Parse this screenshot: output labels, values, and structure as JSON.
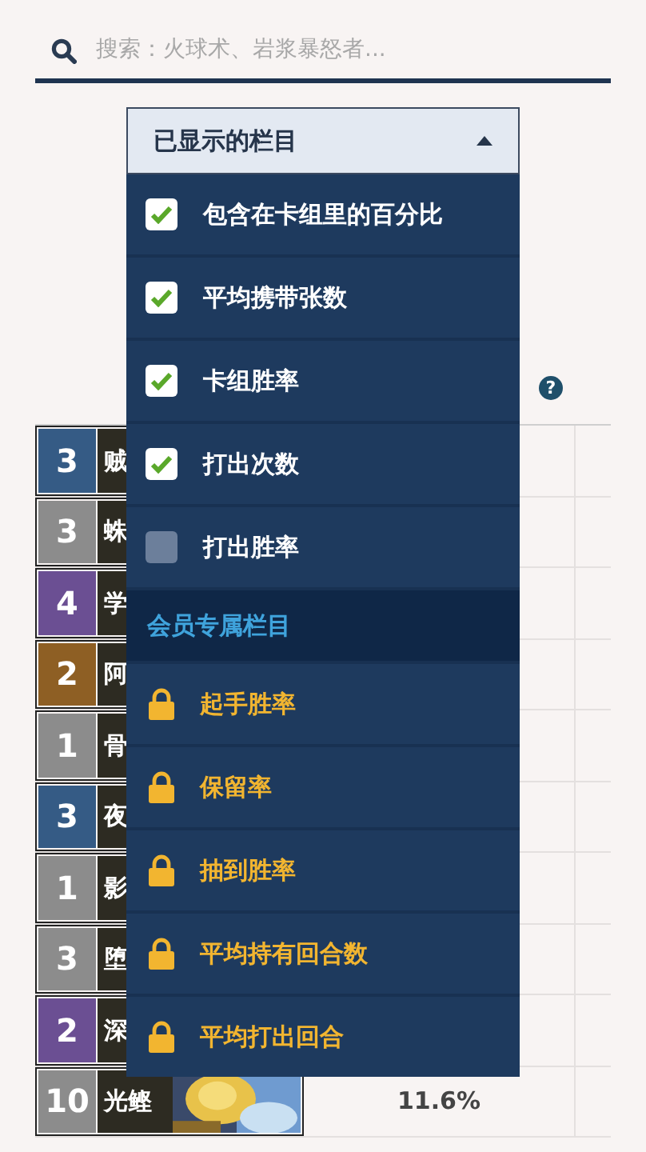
{
  "search": {
    "placeholder": "搜索：火球术、岩浆暴怒者..."
  },
  "help_button": "?",
  "columns_menu": {
    "title": "已显示的栏目",
    "expanded": true,
    "items": [
      {
        "label": "包含在卡组里的百分比",
        "checked": true
      },
      {
        "label": "平均携带张数",
        "checked": true
      },
      {
        "label": "卡组胜率",
        "checked": true
      },
      {
        "label": "打出次数",
        "checked": true
      },
      {
        "label": "打出胜率",
        "checked": false
      }
    ],
    "premium_title": "会员专属栏目",
    "premium_items": [
      {
        "label": "起手胜率",
        "locked": true
      },
      {
        "label": "保留率",
        "locked": true
      },
      {
        "label": "抽到胜率",
        "locked": true
      },
      {
        "label": "平均持有回合数",
        "locked": true
      },
      {
        "label": "平均打出回合",
        "locked": true
      }
    ]
  },
  "table": {
    "rows": [
      {
        "cost": "3",
        "color": "#355b85",
        "name": "贼"
      },
      {
        "cost": "3",
        "color": "#8c8c8c",
        "name": "蛛"
      },
      {
        "cost": "4",
        "color": "#6b4f93",
        "name": "学"
      },
      {
        "cost": "2",
        "color": "#8e5f24",
        "name": "阿"
      },
      {
        "cost": "1",
        "color": "#8c8c8c",
        "name": "骨"
      },
      {
        "cost": "3",
        "color": "#355b85",
        "name": "夜"
      },
      {
        "cost": "1",
        "color": "#8c8c8c",
        "name": "影"
      },
      {
        "cost": "3",
        "color": "#8c8c8c",
        "name": "堕"
      },
      {
        "cost": "2",
        "color": "#6b4f93",
        "name": "深"
      },
      {
        "cost": "10",
        "color": "#8c8c8c",
        "name": "光鲣",
        "value": "11.6%",
        "picture": true
      }
    ]
  }
}
